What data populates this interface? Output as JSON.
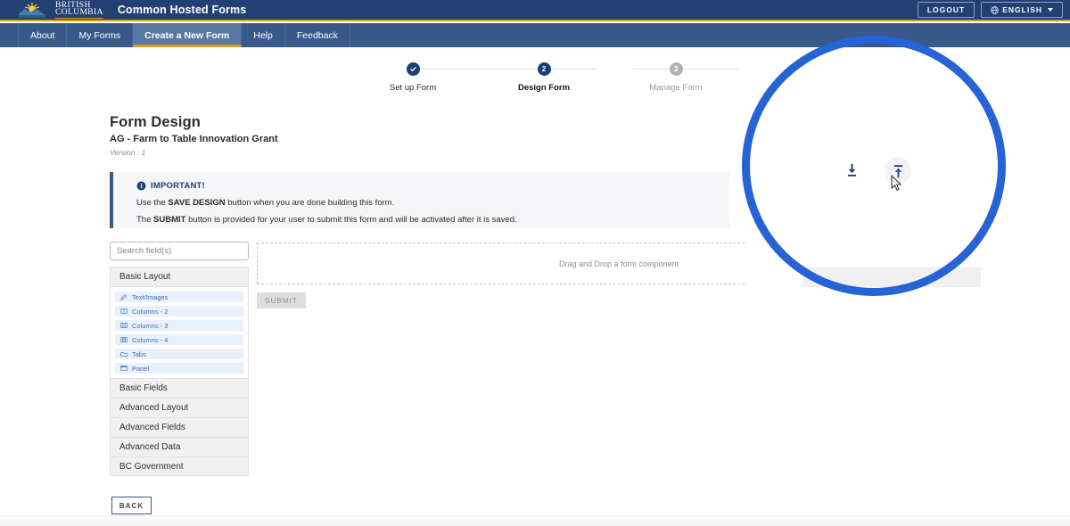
{
  "header": {
    "brand_line1": "BRITISH",
    "brand_line2": "COLUMBIA",
    "app_title": "Common Hosted Forms",
    "logout_label": "LOGOUT",
    "language_label": "ENGLISH"
  },
  "nav": {
    "items": [
      {
        "label": "About",
        "active": false
      },
      {
        "label": "My Forms",
        "active": false
      },
      {
        "label": "Create a New Form",
        "active": true
      },
      {
        "label": "Help",
        "active": false
      },
      {
        "label": "Feedback",
        "active": false
      }
    ]
  },
  "stepper": {
    "steps": [
      {
        "number": "1",
        "label": "Set up Form",
        "state": "done"
      },
      {
        "number": "2",
        "label": "Design Form",
        "state": "current"
      },
      {
        "number": "3",
        "label": "Manage Form",
        "state": "todo"
      }
    ]
  },
  "page": {
    "title": "Form Design",
    "form_name": "AG - Farm to Table Innovation Grant",
    "version": "Version : 1"
  },
  "alert": {
    "heading": "IMPORTANT!",
    "line1_pre": "Use the ",
    "line1_bold": "SAVE DESIGN",
    "line1_post": " button when you are done building this form.",
    "line2_pre": "The ",
    "line2_bold": "SUBMIT",
    "line2_post": " button is provided for your user to submit this form and will be activated after it is saved."
  },
  "sidebar": {
    "search_placeholder": "Search field(s)",
    "search_value": "",
    "groups": [
      {
        "label": "Basic Layout",
        "expanded": true,
        "items": [
          {
            "label": "Text/Images",
            "icon": "text-image-icon"
          },
          {
            "label": "Columns - 2",
            "icon": "columns-icon"
          },
          {
            "label": "Columns - 3",
            "icon": "columns-icon"
          },
          {
            "label": "Columns - 4",
            "icon": "columns-icon"
          },
          {
            "label": "Tabs",
            "icon": "folder-icon"
          },
          {
            "label": "Panel",
            "icon": "panel-icon"
          }
        ]
      },
      {
        "label": "Basic Fields",
        "expanded": false,
        "items": []
      },
      {
        "label": "Advanced Layout",
        "expanded": false,
        "items": []
      },
      {
        "label": "Advanced Fields",
        "expanded": false,
        "items": []
      },
      {
        "label": "Advanced Data",
        "expanded": false,
        "items": []
      },
      {
        "label": "BC Government",
        "expanded": false,
        "items": []
      }
    ]
  },
  "canvas": {
    "dropzone_text": "Drag and Drop a form component",
    "submit_label": "SUBMIT"
  },
  "actions": {
    "download_icon": "download-icon",
    "upload_icon": "upload-icon",
    "hovered": "upload-icon"
  },
  "footer": {
    "back_label": "BACK"
  },
  "colors": {
    "header_blue": "#234075",
    "nav_blue": "#38598a",
    "gold_accent": "#d4a017",
    "annotation_blue": "#2563d6",
    "component_text": "#3a6fb5",
    "component_bg": "#e8f0fb"
  }
}
